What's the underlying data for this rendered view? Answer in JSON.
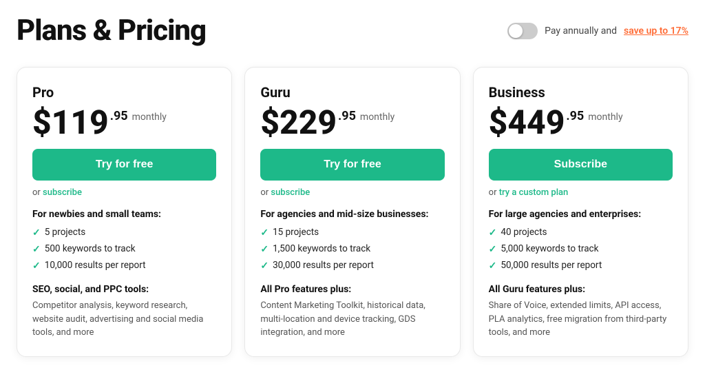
{
  "header": {
    "title": "Plans & Pricing",
    "billing": {
      "label": "Pay annually and ",
      "save_text": "save up to 17%"
    }
  },
  "plans": [
    {
      "id": "pro",
      "name": "Pro",
      "price_main": "$119",
      "price_cents": ".95",
      "price_period": "monthly",
      "cta_label": "Try for free",
      "or_text": "or ",
      "subscribe_label": "subscribe",
      "audience_label": "For newbies and small teams:",
      "features": [
        "5 projects",
        "500 keywords to track",
        "10,000 results per report"
      ],
      "tools_label": "SEO, social, and PPC tools:",
      "tools_desc": "Competitor analysis, keyword research, website audit, advertising and social media tools, and more"
    },
    {
      "id": "guru",
      "name": "Guru",
      "price_main": "$229",
      "price_cents": ".95",
      "price_period": "monthly",
      "cta_label": "Try for free",
      "or_text": "or ",
      "subscribe_label": "subscribe",
      "audience_label": "For agencies and mid-size businesses:",
      "features": [
        "15 projects",
        "1,500 keywords to track",
        "30,000 results per report"
      ],
      "tools_label": "All Pro features plus:",
      "tools_desc": "Content Marketing Toolkit, historical data, multi-location and device tracking, GDS integration, and more"
    },
    {
      "id": "business",
      "name": "Business",
      "price_main": "$449",
      "price_cents": ".95",
      "price_period": "monthly",
      "cta_label": "Subscribe",
      "or_text": "or ",
      "subscribe_label": "try a custom plan",
      "audience_label": "For large agencies and enterprises:",
      "features": [
        "40 projects",
        "5,000 keywords to track",
        "50,000 results per report"
      ],
      "tools_label": "All Guru features plus:",
      "tools_desc": "Share of Voice, extended limits, API access, PLA analytics, free migration from third-party tools, and more"
    }
  ]
}
